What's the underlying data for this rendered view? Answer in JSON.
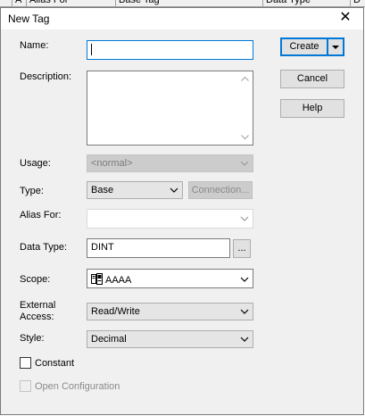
{
  "background_grid": {
    "columns": [
      "A",
      "Alias For",
      "Base Tag",
      "Data Type",
      "D"
    ]
  },
  "dialog": {
    "title": "New Tag",
    "close_glyph": "✕"
  },
  "labels": {
    "name": "Name:",
    "description": "Description:",
    "usage": "Usage:",
    "type": "Type:",
    "alias_for": "Alias For:",
    "data_type": "Data Type:",
    "scope": "Scope:",
    "external_access_line1": "External",
    "external_access_line2": "Access:",
    "style": "Style:"
  },
  "fields": {
    "name_value": "",
    "usage_value": "<normal>",
    "type_value": "Base",
    "alias_for_value": "",
    "data_type_value": "DINT",
    "scope_value": "AAAA",
    "external_access_value": "Read/Write",
    "style_value": "Decimal"
  },
  "buttons": {
    "create": "Create",
    "cancel": "Cancel",
    "help": "Help",
    "connection": "Connection...",
    "browse": "..."
  },
  "checkboxes": {
    "constant": "Constant",
    "open_configuration": "Open Configuration"
  },
  "icons": {
    "close": "close-icon",
    "dropdown": "chevron-down-icon",
    "scope": "program-scope-icon",
    "scroll_up": "scroll-up-icon",
    "scroll_down": "scroll-down-icon"
  },
  "colors": {
    "focus_blue": "#0078d7",
    "dialog_bg": "#f0f0f0",
    "disabled_text": "#8a8a8a"
  }
}
